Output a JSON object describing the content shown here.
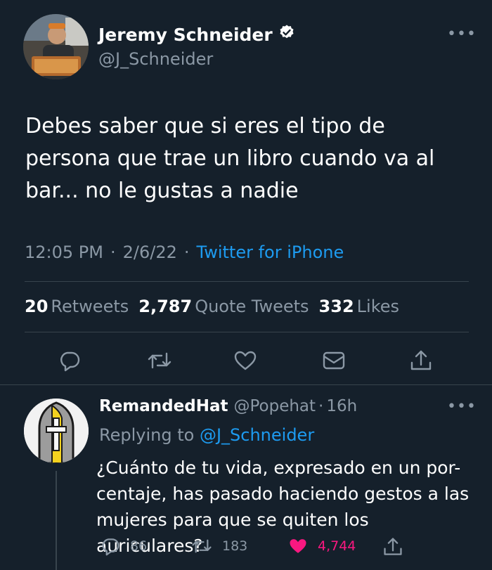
{
  "tweet": {
    "author_name": "Jeremy Schneider",
    "author_handle": "@J_Schneider",
    "text": "Debes saber que si eres el tipo de persona que trae un libro cuando va al bar... no le gustas a nadie",
    "time": "12:05 PM",
    "date": "2/6/22",
    "client": "Twitter for iPhone",
    "retweets_count": "20",
    "retweets_label": "Retweets",
    "quotes_count": "2,787",
    "quotes_label": "Quote Tweets",
    "likes_count": "332",
    "likes_label": "Likes"
  },
  "reply": {
    "author_name": "RemandedHat",
    "author_handle": "@Popehat",
    "age": "16h",
    "replying_prefix": "Replying to",
    "replying_handle": "@J_Schneider",
    "text": "¿Cuánto de tu vida, expresado en un porcentaje, has pasado haciendo gestos a las mujeres para que se quiten los auriculares?",
    "replies": "86",
    "retweets": "183",
    "likes": "4,744"
  },
  "icons": [
    "verified-badge-icon",
    "more-icon",
    "reply-icon",
    "retweet-icon",
    "like-icon",
    "share-via-dm-icon",
    "share-icon"
  ],
  "colors": {
    "background": "#15202b",
    "accent": "#1d9bf0",
    "muted": "#8b98a5",
    "like": "#f91880"
  }
}
